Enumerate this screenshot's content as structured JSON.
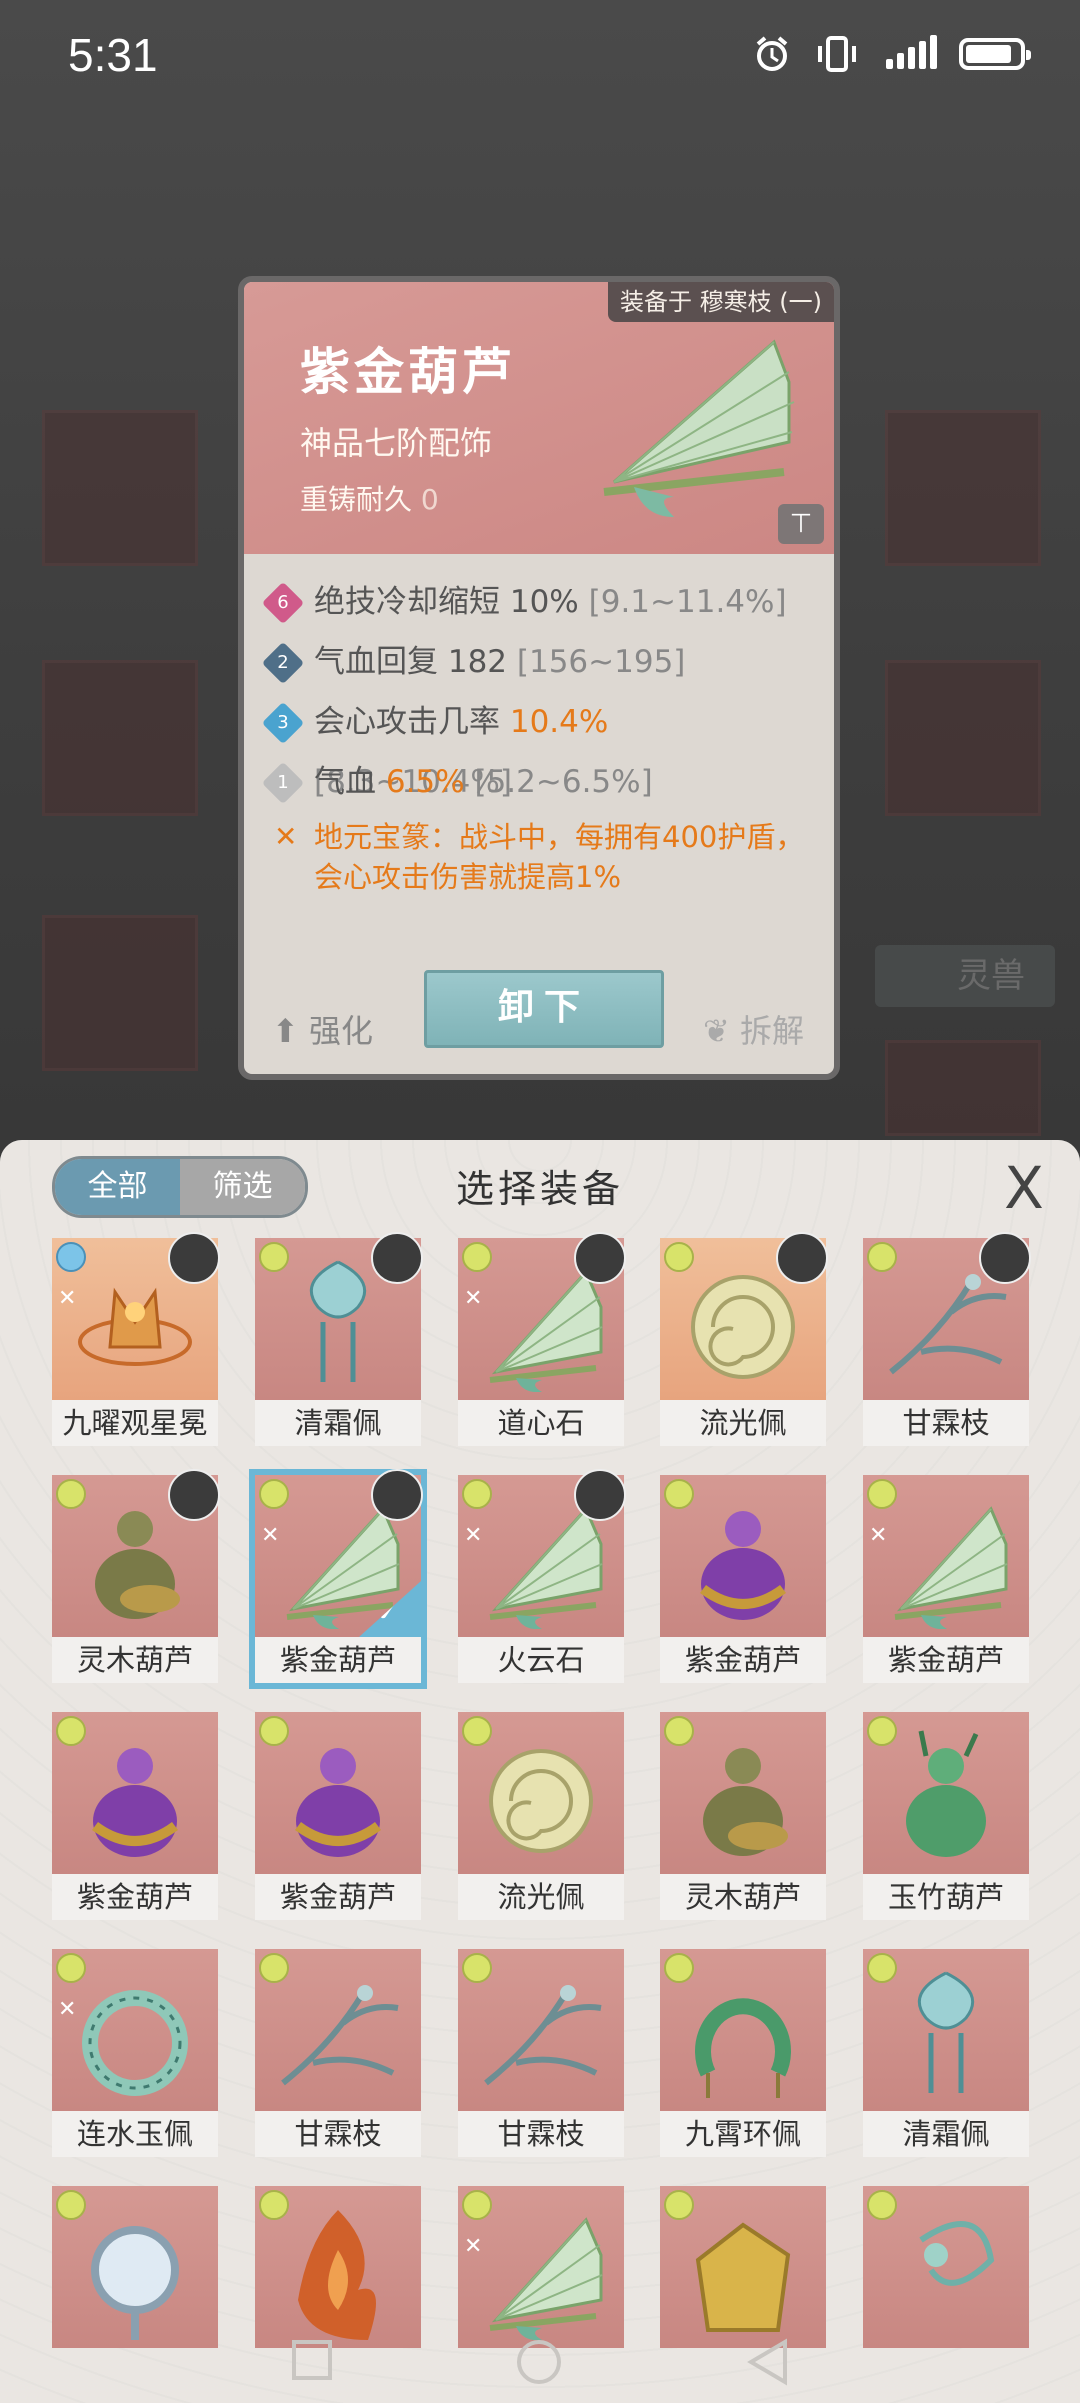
{
  "status_bar": {
    "time": "5:31"
  },
  "detail": {
    "equipped_on": "装备于 穆寒枝 (一)",
    "name": "紫金葫芦",
    "grade": "神品七阶配饰",
    "durability_label": "重铸耐久",
    "durability_value": "0",
    "stats": [
      {
        "badge": "6",
        "color": "#d05a8a",
        "key": "绝技冷却缩短",
        "value": "10%",
        "range": "[9.1~11.4%]",
        "highlight": false
      },
      {
        "badge": "2",
        "color": "#4f6f88",
        "key": "气血回复",
        "value": "182",
        "range": "[156~195]",
        "highlight": false
      },
      {
        "badge": "3",
        "color": "#4aa3cf",
        "key": "会心攻击几率",
        "value": "10.4%",
        "range": "[8.3~10.4%]",
        "highlight": true
      },
      {
        "badge": "1",
        "color": "#bdbdbd",
        "key": "气血",
        "value": "6.5%",
        "range": "[5.2~6.5%]",
        "highlight": true
      }
    ],
    "special_text": "地元宝篆：战斗中，每拥有400护盾，会心攻击伤害就提高1%",
    "strengthen_label": "强化",
    "unequip_label": "卸下",
    "dismantle_label": "拆解"
  },
  "bg": {
    "tab_label": "灵兽"
  },
  "panel": {
    "filter_all": "全部",
    "filter_screen": "筛选",
    "title": "选择装备",
    "close_label": "X"
  },
  "grid": [
    {
      "label": "九曜观星冕",
      "rank": "blue",
      "tag": true,
      "avatar": true,
      "lock": true,
      "orange": true,
      "art": "crown"
    },
    {
      "label": "清霜佩",
      "rank": "green",
      "tag": false,
      "avatar": true,
      "lock": false,
      "orange": false,
      "art": "pendant"
    },
    {
      "label": "道心石",
      "rank": "green",
      "tag": true,
      "avatar": true,
      "lock": false,
      "orange": false,
      "art": "fan"
    },
    {
      "label": "流光佩",
      "rank": "green",
      "tag": false,
      "avatar": true,
      "lock": false,
      "orange": true,
      "art": "ring"
    },
    {
      "label": "甘霖枝",
      "rank": "green",
      "tag": false,
      "avatar": true,
      "lock": false,
      "orange": false,
      "art": "branch"
    },
    {
      "label": "灵木葫芦",
      "rank": "green",
      "tag": false,
      "avatar": true,
      "lock": false,
      "orange": false,
      "art": "gourd-olive"
    },
    {
      "label": "紫金葫芦",
      "rank": "green",
      "tag": true,
      "avatar": true,
      "lock": true,
      "orange": false,
      "art": "fan",
      "selected": true
    },
    {
      "label": "火云石",
      "rank": "green",
      "tag": true,
      "avatar": true,
      "lock": true,
      "orange": false,
      "art": "fan"
    },
    {
      "label": "紫金葫芦",
      "rank": "green",
      "tag": false,
      "avatar": false,
      "lock": true,
      "orange": false,
      "art": "gourd-purple"
    },
    {
      "label": "紫金葫芦",
      "rank": "green",
      "tag": true,
      "avatar": false,
      "lock": true,
      "orange": false,
      "art": "fan"
    },
    {
      "label": "紫金葫芦",
      "rank": "green",
      "tag": false,
      "avatar": false,
      "lock": true,
      "orange": false,
      "art": "gourd-purple"
    },
    {
      "label": "紫金葫芦",
      "rank": "green",
      "tag": false,
      "avatar": false,
      "lock": true,
      "orange": false,
      "art": "gourd-purple"
    },
    {
      "label": "流光佩",
      "rank": "green",
      "tag": false,
      "avatar": false,
      "lock": false,
      "orange": false,
      "art": "ring"
    },
    {
      "label": "灵木葫芦",
      "rank": "green",
      "tag": false,
      "avatar": false,
      "lock": true,
      "orange": false,
      "art": "gourd-olive"
    },
    {
      "label": "玉竹葫芦",
      "rank": "green",
      "tag": false,
      "avatar": false,
      "lock": true,
      "orange": false,
      "art": "gourd-green"
    },
    {
      "label": "连水玉佩",
      "rank": "green",
      "tag": true,
      "avatar": false,
      "lock": true,
      "orange": false,
      "art": "wreath"
    },
    {
      "label": "甘霖枝",
      "rank": "green",
      "tag": false,
      "avatar": false,
      "lock": true,
      "orange": false,
      "art": "branch"
    },
    {
      "label": "甘霖枝",
      "rank": "green",
      "tag": false,
      "avatar": false,
      "lock": true,
      "orange": false,
      "art": "branch"
    },
    {
      "label": "九霄环佩",
      "rank": "green",
      "tag": false,
      "avatar": false,
      "lock": false,
      "orange": false,
      "art": "horseshoe"
    },
    {
      "label": "清霜佩",
      "rank": "green",
      "tag": false,
      "avatar": false,
      "lock": true,
      "orange": false,
      "art": "pendant"
    },
    {
      "label": "",
      "rank": "green",
      "tag": false,
      "avatar": false,
      "lock": false,
      "orange": false,
      "art": "mirror"
    },
    {
      "label": "",
      "rank": "green",
      "tag": false,
      "avatar": false,
      "lock": false,
      "orange": false,
      "art": "flame"
    },
    {
      "label": "",
      "rank": "green",
      "tag": true,
      "avatar": false,
      "lock": false,
      "orange": false,
      "art": "fan"
    },
    {
      "label": "",
      "rank": "green",
      "tag": false,
      "avatar": false,
      "lock": false,
      "orange": false,
      "art": "gold"
    },
    {
      "label": "",
      "rank": "green",
      "tag": false,
      "avatar": false,
      "lock": false,
      "orange": false,
      "art": "bead"
    }
  ]
}
